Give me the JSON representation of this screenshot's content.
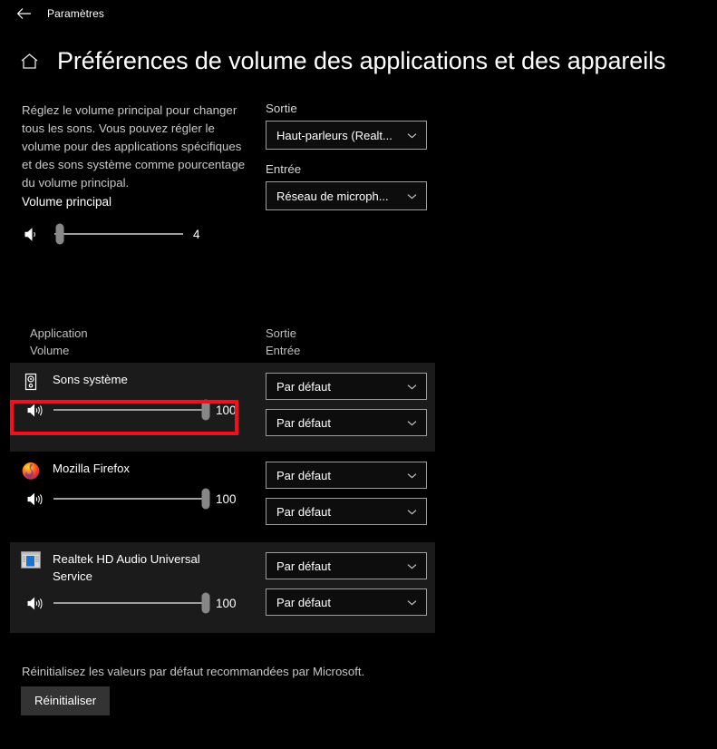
{
  "titlebar": {
    "back_icon": "back-arrow-icon",
    "app_name": "Paramètres"
  },
  "header": {
    "home_icon": "home-icon",
    "title": "Préférences de volume des applications et des appareils"
  },
  "intro": {
    "description": "Réglez le volume principal pour changer tous les sons. Vous pouvez régler le volume pour des applications spécifiques et des sons système comme pourcentage du volume principal.",
    "master_label": "Volume principal",
    "master_icon": "speaker-icon",
    "master_value": "4",
    "master_percent": 4
  },
  "devices": {
    "output_label": "Sortie",
    "output_value": "Haut-parleurs (Realt...",
    "input_label": "Entrée",
    "input_value": "Réseau de microph..."
  },
  "list_headers": {
    "left_line1": "Application",
    "left_line2": "Volume",
    "right_line1": "Sortie",
    "right_line2": "Entrée"
  },
  "apps": [
    {
      "name": "Sons système",
      "icon": "system-sounds-icon",
      "volume_icon": "speaker-waves-icon",
      "volume_value": "100",
      "volume_percent": 100,
      "output": "Par défaut",
      "input": "Par défaut",
      "highlighted": true
    },
    {
      "name": "Mozilla Firefox",
      "icon": "firefox-icon",
      "volume_icon": "speaker-waves-icon",
      "volume_value": "100",
      "volume_percent": 100,
      "output": "Par défaut",
      "input": "Par défaut",
      "highlighted": false
    },
    {
      "name": "Realtek HD Audio Universal Service",
      "icon": "realtek-window-icon",
      "volume_icon": "speaker-waves-icon",
      "volume_value": "100",
      "volume_percent": 100,
      "output": "Par défaut",
      "input": "Par défaut",
      "highlighted": false
    }
  ],
  "footer": {
    "text": "Réinitialisez les valeurs par défaut recommandées par Microsoft.",
    "button_label": "Réinitialiser"
  },
  "colors": {
    "background": "#000000",
    "row_alt": "#1b1b1b",
    "accent_highlight": "#f01020",
    "text_primary": "#ffffff",
    "text_secondary": "#c8c8c8",
    "control_border": "#9d9d9d"
  }
}
